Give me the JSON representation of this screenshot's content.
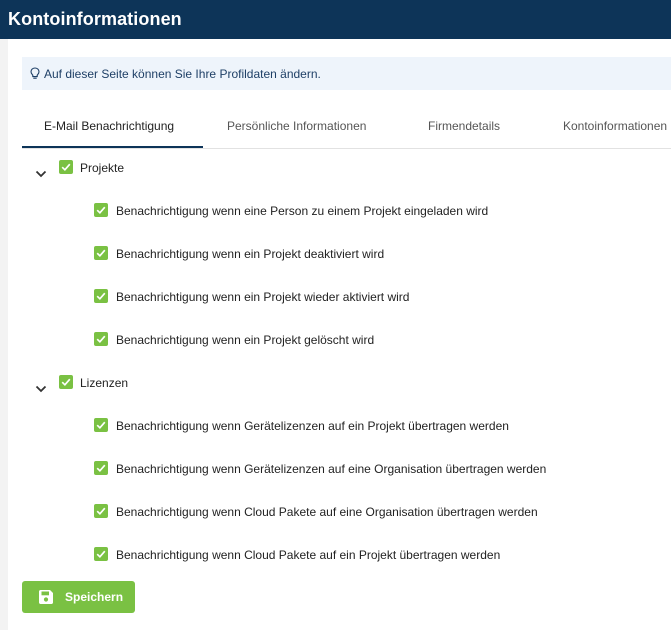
{
  "header": {
    "title": "Kontoinformationen"
  },
  "info": {
    "text": "Auf dieser Seite können Sie Ihre Profildaten ändern.",
    "icon": "lightbulb-icon"
  },
  "tabs": [
    {
      "label": "E-Mail Benachrichtigung",
      "active": true
    },
    {
      "label": "Persönliche Informationen",
      "active": false
    },
    {
      "label": "Firmendetails",
      "active": false
    },
    {
      "label": "Kontoinformationen",
      "active": false
    }
  ],
  "groups": [
    {
      "label": "Projekte",
      "checked": true,
      "expanded": true,
      "items": [
        {
          "label": "Benachrichtigung wenn eine Person zu einem Projekt eingeladen wird",
          "checked": true
        },
        {
          "label": "Benachrichtigung wenn ein Projekt deaktiviert wird",
          "checked": true
        },
        {
          "label": "Benachrichtigung wenn ein Projekt wieder aktiviert wird",
          "checked": true
        },
        {
          "label": "Benachrichtigung wenn ein Projekt gelöscht wird",
          "checked": true
        }
      ]
    },
    {
      "label": "Lizenzen",
      "checked": true,
      "expanded": true,
      "items": [
        {
          "label": "Benachrichtigung wenn Gerätelizenzen auf ein Projekt übertragen werden",
          "checked": true
        },
        {
          "label": "Benachrichtigung wenn Gerätelizenzen auf eine Organisation übertragen werden",
          "checked": true
        },
        {
          "label": "Benachrichtigung wenn Cloud Pakete auf eine Organisation übertragen werden",
          "checked": true
        },
        {
          "label": "Benachrichtigung wenn Cloud Pakete auf ein Projekt übertragen werden",
          "checked": true
        }
      ]
    }
  ],
  "save_button": {
    "label": "Speichern",
    "icon": "floppy-disk-icon"
  },
  "colors": {
    "header_bg": "#0d3458",
    "accent_green": "#7ac143",
    "info_bg": "#eef4fb"
  }
}
